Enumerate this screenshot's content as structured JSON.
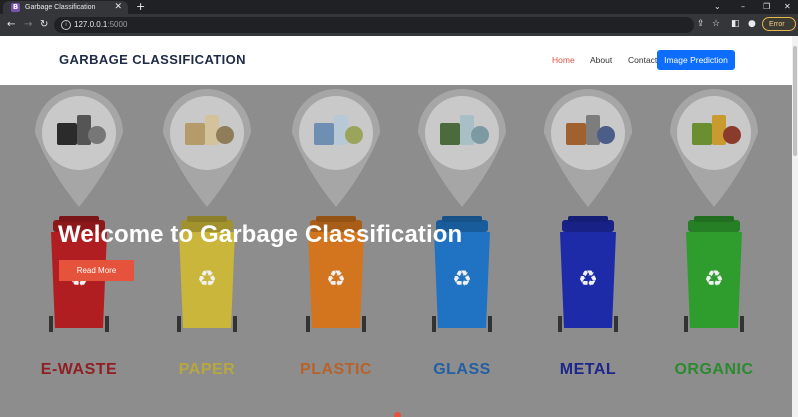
{
  "browser": {
    "tab_title": "Garbage Classification",
    "tab_favicon_letter": "B",
    "url_host": "127.0.0.1",
    "url_port": ":5000",
    "error_label": "Error"
  },
  "header": {
    "brand": "GARBAGE CLASSIFICATION",
    "nav": [
      {
        "label": "Home"
      },
      {
        "label": "About"
      },
      {
        "label": "Contact"
      }
    ],
    "predict_button": "Image Prediction"
  },
  "hero": {
    "title": "Welcome to Garbage Classification",
    "read_more": "Read More",
    "bins": [
      {
        "label": "E-WASTE",
        "color": "#b01e21",
        "text_color": "#8f1f22",
        "contents": "electronics"
      },
      {
        "label": "PAPER",
        "color": "#c9b63a",
        "text_color": "#b8a63f",
        "contents": "paper"
      },
      {
        "label": "PLASTIC",
        "color": "#d3751e",
        "text_color": "#b8622a",
        "contents": "plastic"
      },
      {
        "label": "GLASS",
        "color": "#1f73c2",
        "text_color": "#225fa3",
        "contents": "glass"
      },
      {
        "label": "METAL",
        "color": "#1e2ba8",
        "text_color": "#1c268b",
        "contents": "metal"
      },
      {
        "label": "ORGANIC",
        "color": "#2f9d2e",
        "text_color": "#2b8a2e",
        "contents": "organic"
      }
    ]
  },
  "colors": {
    "accent": "#e5533c",
    "primary": "#0d6efd",
    "brand_text": "#1e2b47",
    "hero_overlay": "#8d8d8e"
  }
}
